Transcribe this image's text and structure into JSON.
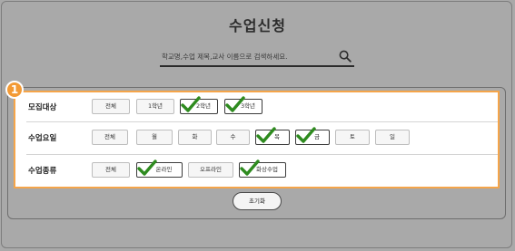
{
  "page": {
    "title": "수업신청"
  },
  "search": {
    "placeholder": "학교명,수업 제목,교사 이름으로 검색하세요.",
    "value": ""
  },
  "badge": "1",
  "filters": {
    "target": {
      "label": "모집대상",
      "options": [
        {
          "label": "전체",
          "selected": false
        },
        {
          "label": "1학년",
          "selected": false
        },
        {
          "label": "2학년",
          "selected": true
        },
        {
          "label": "3학년",
          "selected": true
        }
      ]
    },
    "day": {
      "label": "수업요일",
      "options": [
        {
          "label": "전체",
          "selected": false
        },
        {
          "label": "월",
          "selected": false
        },
        {
          "label": "화",
          "selected": false
        },
        {
          "label": "수",
          "selected": false
        },
        {
          "label": "목",
          "selected": true
        },
        {
          "label": "금",
          "selected": true
        },
        {
          "label": "토",
          "selected": false
        },
        {
          "label": "일",
          "selected": false
        }
      ]
    },
    "type": {
      "label": "수업종류",
      "options": [
        {
          "label": "전체",
          "selected": false
        },
        {
          "label": "온라인",
          "selected": true
        },
        {
          "label": "오프라인",
          "selected": false
        },
        {
          "label": "화상수업",
          "selected": true
        }
      ]
    }
  },
  "reset": {
    "label": "초기화"
  },
  "colors": {
    "highlight": "#f5a54a",
    "badge": "#f39a35",
    "check": "#2e8b1f",
    "overlay": "#a9a9a9"
  }
}
